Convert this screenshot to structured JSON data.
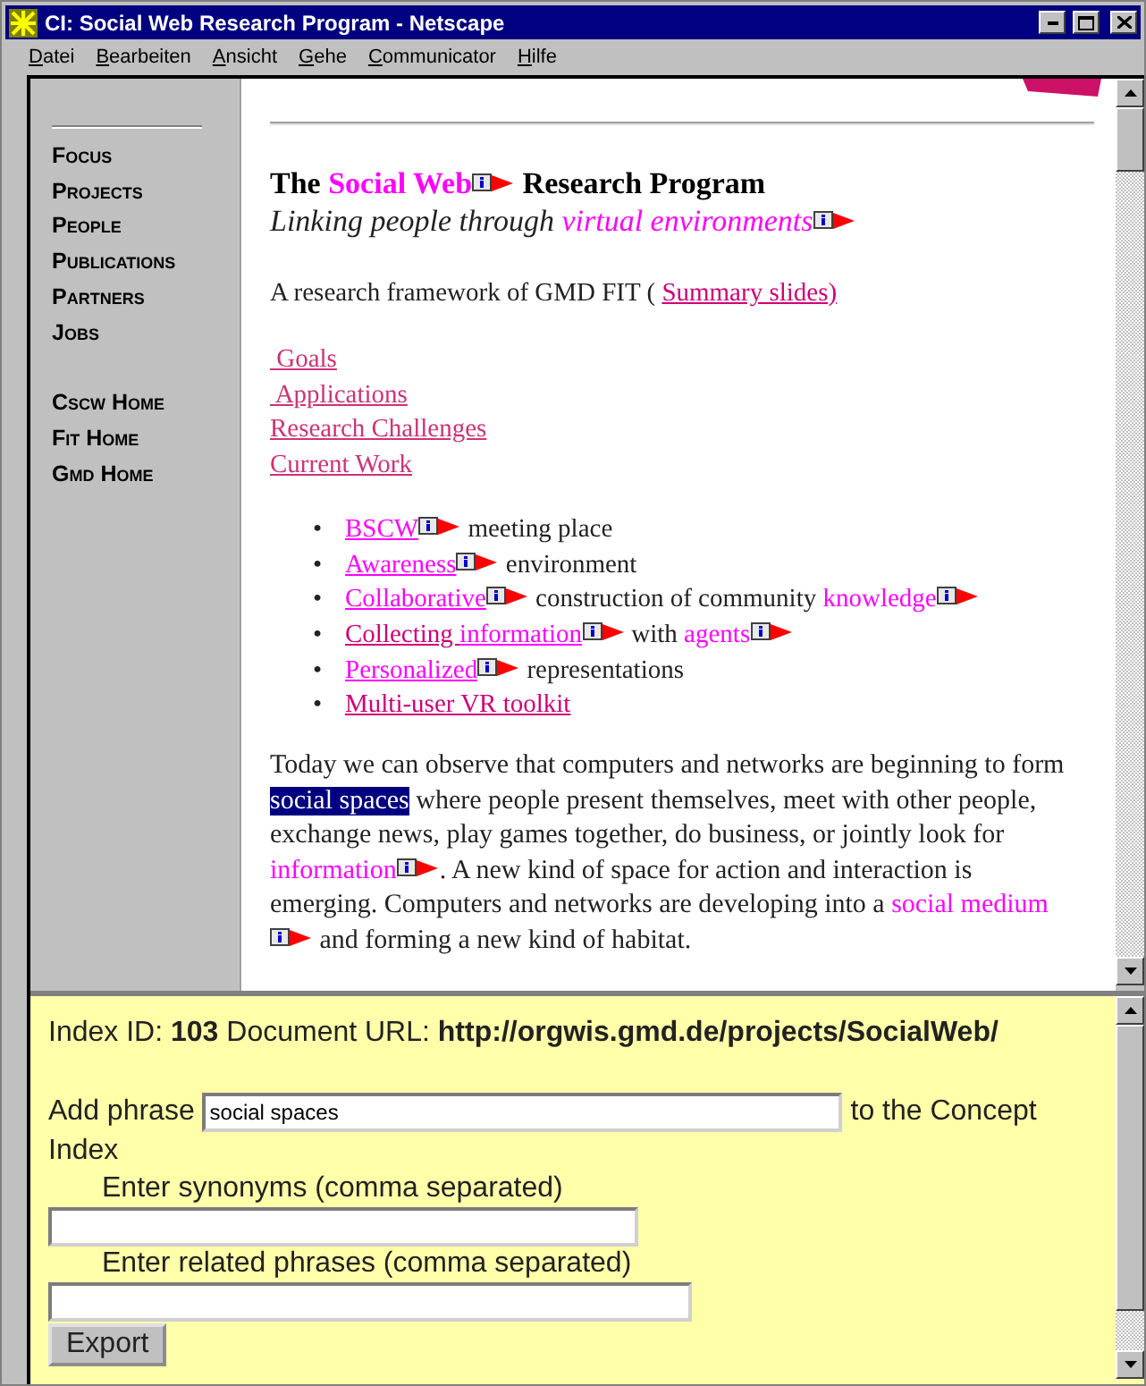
{
  "window": {
    "title": "CI: Social Web Research Program - Netscape"
  },
  "menu": [
    "Datei",
    "Bearbeiten",
    "Ansicht",
    "Gehe",
    "Communicator",
    "Hilfe"
  ],
  "sidebar": {
    "groups": [
      [
        "Focus",
        "Projects",
        "People",
        "Publications",
        "Partners",
        "Jobs"
      ],
      [
        "Cscw Home",
        "Fit Home",
        "Gmd Home"
      ]
    ]
  },
  "content": {
    "heading": [
      {
        "kind": "text",
        "text": "The "
      },
      {
        "kind": "concept",
        "text": "Social Web",
        "marker": true
      },
      {
        "kind": "text",
        "text": " Research Program"
      }
    ],
    "subtitle": [
      {
        "kind": "text",
        "text": "Linking people through "
      },
      {
        "kind": "concept",
        "text": "virtual environments",
        "marker": true
      }
    ],
    "intro": [
      {
        "kind": "text",
        "text": "A research framework of GMD FIT ( "
      },
      {
        "kind": "visited",
        "text": "Summary slides)"
      }
    ],
    "sections": [
      {
        "text": " Goals"
      },
      {
        "text": " Applications"
      },
      {
        "text": "Research Challenges"
      },
      {
        "text": "Current Work"
      }
    ],
    "bullet_marker": "•",
    "bullets": [
      [
        {
          "kind": "link",
          "text": "BSCW",
          "marker": true
        },
        {
          "kind": "text",
          "text": " meeting place"
        }
      ],
      [
        {
          "kind": "link",
          "text": "Awareness",
          "marker": true
        },
        {
          "kind": "text",
          "text": " environment"
        }
      ],
      [
        {
          "kind": "link",
          "text": "Collaborative",
          "marker": true
        },
        {
          "kind": "text",
          "text": " construction of community "
        },
        {
          "kind": "concept",
          "text": "knowledge",
          "marker": true
        }
      ],
      [
        {
          "kind": "visited",
          "text": "Collecting "
        },
        {
          "kind": "link",
          "text": "information",
          "marker": true
        },
        {
          "kind": "text",
          "text": " with "
        },
        {
          "kind": "concept",
          "text": "agents",
          "marker": true
        }
      ],
      [
        {
          "kind": "link",
          "text": "Personalized",
          "marker": true
        },
        {
          "kind": "text",
          "text": " representations"
        }
      ],
      [
        {
          "kind": "visited",
          "text": "Multi-user VR toolkit"
        }
      ]
    ],
    "paragraph": [
      {
        "kind": "text",
        "text": "Today we can observe that computers and networks are beginning to form "
      },
      {
        "kind": "highlight",
        "text": "social spaces"
      },
      {
        "kind": "text",
        "text": " where people present themselves, meet with other people, exchange news, play games together, do business, or jointly look for "
      },
      {
        "kind": "concept",
        "text": "information",
        "marker": true
      },
      {
        "kind": "text",
        "text": ". A new kind of space for action and interaction is emerging. Computers and networks are developing into a "
      },
      {
        "kind": "concept",
        "text": "social medium",
        "marker": true
      },
      {
        "kind": "text",
        "text": " and forming a new kind of habitat."
      }
    ]
  },
  "index_frame": {
    "info": "Index ID: **103** Document URL: **http://orgwis.gmd.de/projects/SocialWeb/**",
    "add_label": "Add phrase",
    "phrase": {
      "value": "social spaces"
    },
    "add_suffix": "to the Concept Index",
    "synonyms_label": "Enter synonyms (comma separated)",
    "related_label": "Enter related phrases (comma separated)",
    "button": "Export"
  }
}
